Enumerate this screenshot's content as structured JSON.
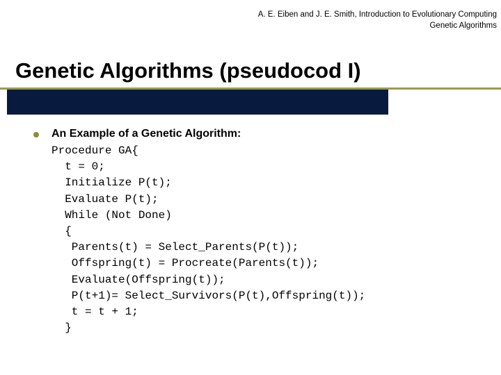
{
  "header": {
    "line1": "A. E. Eiben and J. E. Smith, Introduction to Evolutionary Computing",
    "line2": "Genetic Algorithms"
  },
  "title": "Genetic Algorithms (pseudocod I)",
  "content": {
    "intro": "An Example of a Genetic Algorithm:",
    "code": "Procedure GA{\n  t = 0;\n  Initialize P(t);\n  Evaluate P(t);\n  While (Not Done)\n  {\n   Parents(t) = Select_Parents(P(t));\n   Offspring(t) = Procreate(Parents(t));\n   Evaluate(Offspring(t));\n   P(t+1)= Select_Survivors(P(t),Offspring(t));\n   t = t + 1;\n  }"
  }
}
